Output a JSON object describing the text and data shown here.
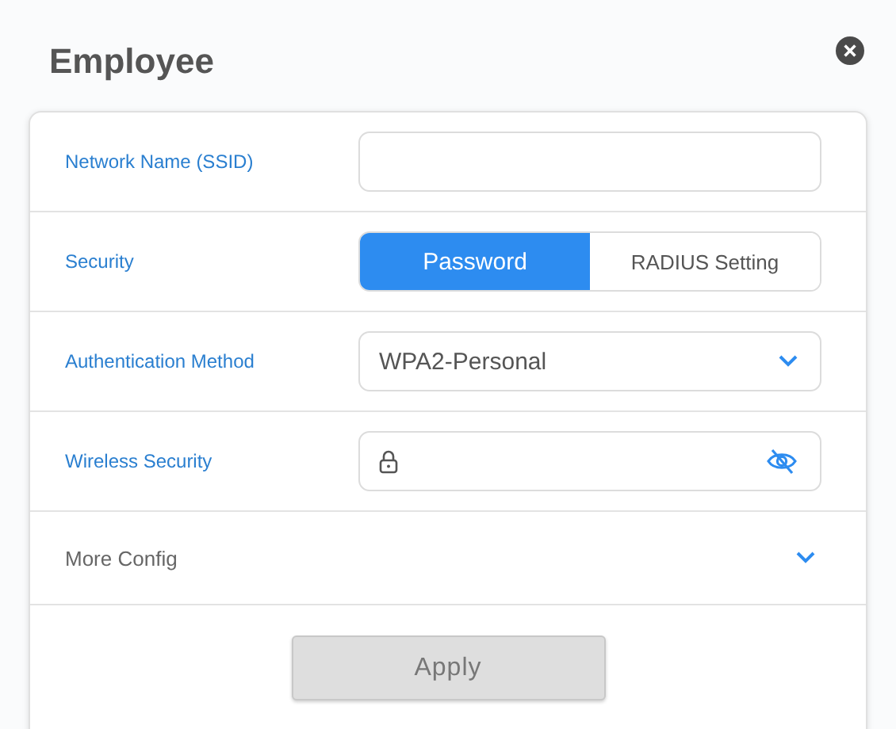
{
  "dialog": {
    "title": "Employee"
  },
  "rows": [
    {
      "kind": "text",
      "label": "Network Name (SSID)"
    },
    {
      "kind": "segmented",
      "label": "Security",
      "options": [
        {
          "label": "Password",
          "selected": true
        },
        {
          "label": "RADIUS Setting",
          "selected": false
        }
      ]
    },
    {
      "kind": "select",
      "label": "Authentication Method",
      "value": "WPA2-Personal"
    },
    {
      "kind": "password",
      "label": "Wireless Security"
    },
    {
      "kind": "expander",
      "label": "More Config",
      "expanded": false
    }
  ],
  "apply_button": {
    "label": "Apply",
    "disabled": true
  }
}
